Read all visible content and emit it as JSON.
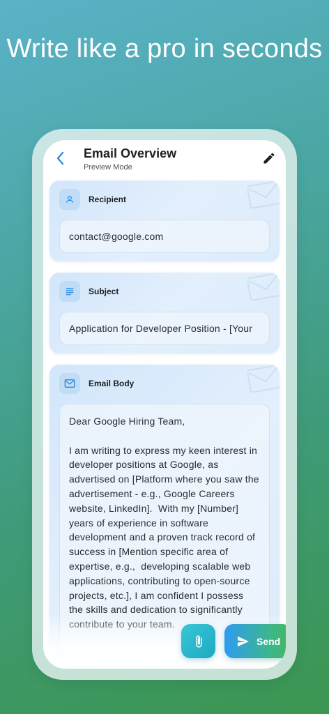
{
  "headline": "Write like a pro in seconds",
  "header": {
    "title": "Email Overview",
    "subtitle": "Preview Mode",
    "back_icon": "arrow-back-icon",
    "edit_icon": "pencil-icon"
  },
  "recipient": {
    "label": "Recipient",
    "icon": "person-icon",
    "value": "contact@google.com"
  },
  "subject": {
    "label": "Subject",
    "icon": "notes-icon",
    "value": "Application for Developer Position - [Your"
  },
  "body": {
    "label": "Email Body",
    "icon": "mail-icon",
    "value": "Dear Google Hiring Team,\n\nI am writing to express my keen interest in developer positions at Google, as advertised on [Platform where you saw the advertisement - e.g., Google Careers website, LinkedIn].  With my [Number] years of experience in software development and a proven track record of success in [Mention specific area of expertise, e.g.,  developing scalable web applications, contributing to open-source projects, etc.], I am confident I possess the skills and dedication to significantly contribute to your team."
  },
  "actions": {
    "attach_icon": "paperclip-icon",
    "send_label": "Send",
    "send_icon": "send-icon"
  },
  "colors": {
    "accent_blue": "#2f9cf0",
    "accent_green": "#48b65c",
    "attach_teal": "#1ea9c2"
  }
}
